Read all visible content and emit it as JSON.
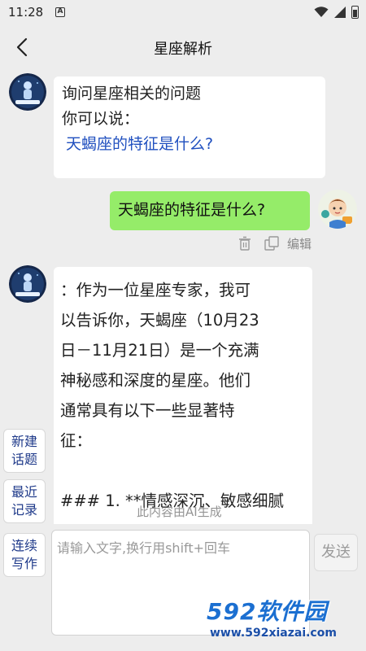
{
  "status": {
    "time": "11:28",
    "indicator": "A"
  },
  "nav": {
    "title": "星座解析"
  },
  "chat": {
    "bot_intro": {
      "line1": "询问星座相关的问题",
      "line2": "你可以说：",
      "suggestion": "天蝎座的特征是什么?"
    },
    "user_msg": "天蝎座的特征是什么?",
    "user_actions": {
      "edit_label": "编辑"
    },
    "bot_answer": {
      "lines": [
        "：作为一位星座专家，我可",
        "以告诉你，天蝎座（10月23",
        "日－11月21日）是一个充满",
        "神秘感和深度的星座。他们",
        "通常具有以下一些显著特",
        "征：",
        "",
        "### 1. **情感深沉、敏感细腻"
      ]
    }
  },
  "side": {
    "new_topic": [
      "新建",
      "话题"
    ],
    "recent": [
      "最近",
      "记录"
    ],
    "continuous": [
      "连续",
      "写作"
    ]
  },
  "ai_notice": "此内容由AI生成",
  "input": {
    "placeholder": "请输入文字,换行用shift+回车",
    "send_label": "发送"
  },
  "watermark": {
    "brand": "592软件园",
    "url": "www.592xiazai.com"
  }
}
